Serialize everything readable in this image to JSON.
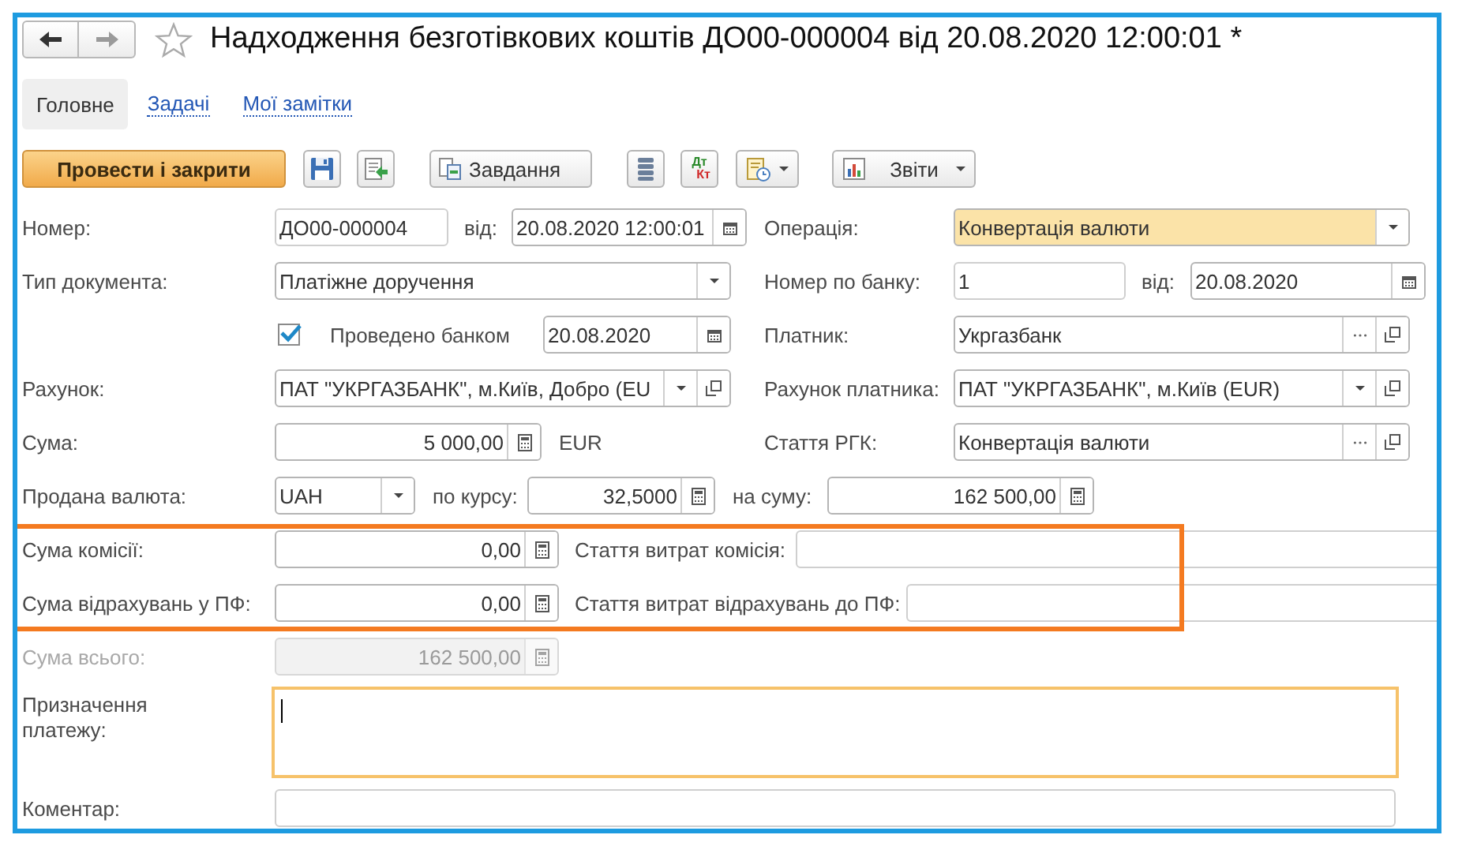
{
  "window": {
    "title": "Надходження безготівкових коштів ДО00-000004 від 20.08.2020 12:00:01 *",
    "favorite": false
  },
  "nav": [
    {
      "kind": "back",
      "disabled": false
    },
    {
      "kind": "forward",
      "disabled": true
    }
  ],
  "tabs": [
    {
      "label": "Головне",
      "selected": true
    },
    {
      "label": "Задачі",
      "selected": false
    },
    {
      "label": "Мої замітки",
      "selected": false
    }
  ],
  "toolbar": [
    {
      "kind": "primary",
      "label": "Провести і закрити"
    },
    {
      "kind": "icon"
    },
    {
      "kind": "icon"
    },
    {
      "kind": "icon_label",
      "label": "Завдання"
    },
    {
      "kind": "icon"
    },
    {
      "kind": "dtkt",
      "top": "Дт",
      "bottom": "Кт"
    },
    {
      "kind": "icon_menu"
    },
    {
      "kind": "icon_label_menu",
      "label": "Звіти"
    }
  ],
  "form": {
    "rows": [
      {
        "disabled": false,
        "outlined": false,
        "items": [
          {
            "kind": "label",
            "text": "Номер:"
          },
          {
            "kind": "field",
            "value": "ДО00-000004"
          },
          {
            "kind": "label",
            "text": "від:"
          },
          {
            "kind": "field",
            "value": "20.08.2020 12:00:01",
            "buttons": [
              {
                "kind": "calendar"
              }
            ]
          },
          {
            "kind": "label",
            "text": "Операція:"
          },
          {
            "kind": "field",
            "value": "Конвертація валюти",
            "highlighted": true,
            "buttons": [
              {
                "kind": "dropdown"
              }
            ]
          }
        ]
      },
      {
        "disabled": false,
        "outlined": false,
        "items": [
          {
            "kind": "label",
            "text": "Тип документа:"
          },
          {
            "kind": "field",
            "value": "Платіжне доручення",
            "buttons": [
              {
                "kind": "dropdown"
              }
            ]
          },
          {
            "kind": "label",
            "text": "Номер по банку:"
          },
          {
            "kind": "field",
            "value": "1"
          },
          {
            "kind": "label",
            "text": "від:"
          },
          {
            "kind": "field",
            "value": "20.08.2020",
            "buttons": [
              {
                "kind": "calendar"
              }
            ]
          }
        ]
      },
      {
        "disabled": false,
        "outlined": false,
        "items": [
          {
            "kind": "checkbox",
            "checked": true
          },
          {
            "kind": "label",
            "text": "Проведено банком"
          },
          {
            "kind": "field",
            "value": "20.08.2020",
            "buttons": [
              {
                "kind": "calendar"
              }
            ]
          },
          {
            "kind": "label",
            "text": "Платник:"
          },
          {
            "kind": "field",
            "value": "Укргазбанк",
            "buttons": [
              {
                "kind": "choose"
              },
              {
                "kind": "open"
              }
            ]
          }
        ]
      },
      {
        "disabled": false,
        "outlined": false,
        "items": [
          {
            "kind": "label",
            "text": "Рахунок:"
          },
          {
            "kind": "field",
            "value": "ПАТ \"УКРГАЗБАНК\", м.Київ, Добро (EU",
            "buttons": [
              {
                "kind": "dropdown"
              },
              {
                "kind": "open"
              }
            ]
          },
          {
            "kind": "label",
            "text": "Рахунок платника:"
          },
          {
            "kind": "field",
            "value": "ПАТ \"УКРГАЗБАНК\", м.Київ (EUR)",
            "buttons": [
              {
                "kind": "dropdown"
              },
              {
                "kind": "open"
              }
            ]
          }
        ]
      },
      {
        "disabled": false,
        "outlined": false,
        "items": [
          {
            "kind": "label",
            "text": "Сума:"
          },
          {
            "kind": "number_field",
            "value": "5 000,00",
            "buttons": [
              {
                "kind": "calculator"
              }
            ]
          },
          {
            "kind": "label",
            "text": "EUR"
          },
          {
            "kind": "label",
            "text": "Стаття РГК:"
          },
          {
            "kind": "field",
            "value": "Конвертація валюти",
            "buttons": [
              {
                "kind": "choose"
              },
              {
                "kind": "open"
              }
            ]
          }
        ]
      },
      {
        "disabled": false,
        "outlined": false,
        "items": [
          {
            "kind": "label",
            "text": "Продана валюта:"
          },
          {
            "kind": "field",
            "value": "UAH",
            "buttons": [
              {
                "kind": "dropdown"
              }
            ]
          },
          {
            "kind": "label",
            "text": "по курсу:"
          },
          {
            "kind": "number_field",
            "value": "32,5000",
            "buttons": [
              {
                "kind": "calculator"
              }
            ]
          },
          {
            "kind": "label",
            "text": "на суму:"
          },
          {
            "kind": "number_field",
            "value": "162 500,00",
            "buttons": [
              {
                "kind": "calculator"
              }
            ]
          }
        ]
      },
      {
        "disabled": false,
        "outlined": true,
        "items": [
          {
            "kind": "label",
            "text": "Сума комісії:"
          },
          {
            "kind": "number_field",
            "value": "0,00",
            "buttons": [
              {
                "kind": "calculator"
              }
            ]
          },
          {
            "kind": "label",
            "text": "Стаття витрат комісія:"
          },
          {
            "kind": "field"
          }
        ]
      },
      {
        "disabled": false,
        "outlined": true,
        "items": [
          {
            "kind": "label",
            "text": "Сума відрахувань у ПФ:"
          },
          {
            "kind": "number_field",
            "value": "0,00",
            "buttons": [
              {
                "kind": "calculator"
              }
            ]
          },
          {
            "kind": "label",
            "text": "Стаття витрат відрахувань до ПФ:"
          },
          {
            "kind": "field"
          }
        ]
      },
      {
        "disabled": true,
        "outlined": false,
        "items": [
          {
            "kind": "label",
            "text": "Сума всього:"
          },
          {
            "kind": "number_field",
            "value": "162 500,00",
            "buttons": [
              {
                "kind": "calculator"
              }
            ]
          }
        ]
      },
      {
        "disabled": false,
        "outlined": false,
        "items": [
          {
            "kind": "label",
            "text": "Призначення платежу:"
          },
          {
            "kind": "textarea",
            "focused": true
          }
        ]
      },
      {
        "disabled": false,
        "outlined": false,
        "items": [
          {
            "kind": "label",
            "text": "Коментар:"
          },
          {
            "kind": "field"
          }
        ]
      }
    ]
  }
}
